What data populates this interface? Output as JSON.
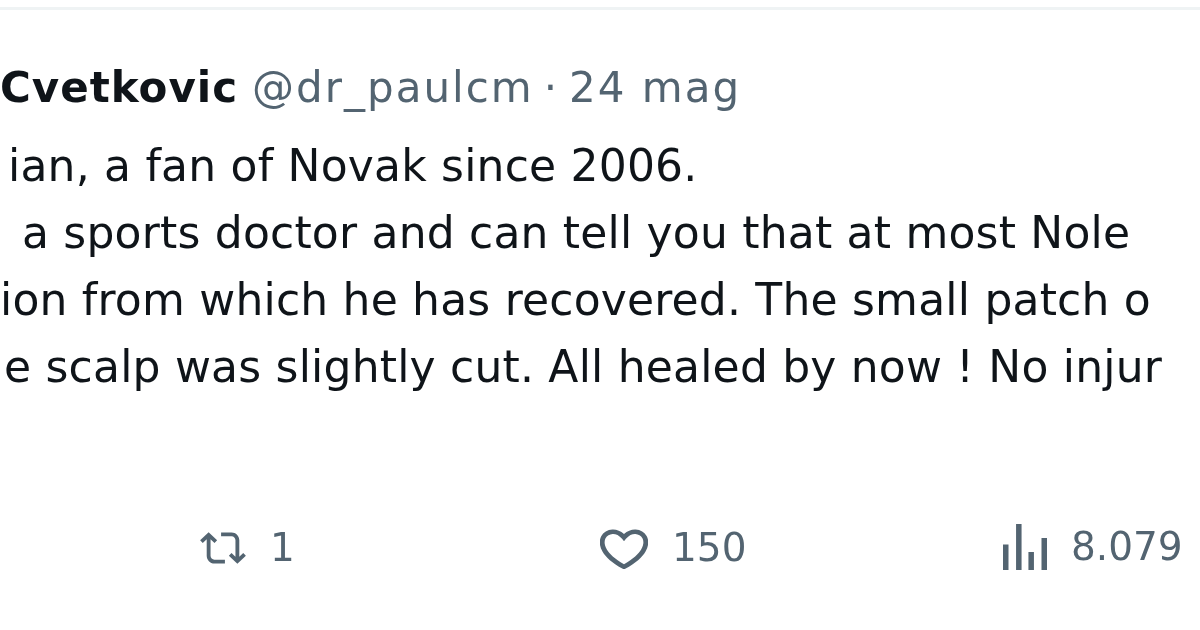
{
  "tweet": {
    "author_name": "Cvetkovic",
    "handle": "@dr_paulcm",
    "separator": "·",
    "date": "24 mag",
    "body_lines": [
      "ian, a fan of Novak since 2006.",
      "a sports doctor and can tell you that at most Nole",
      "ion from which he has recovered. The small patch o",
      "e scalp was slightly cut. All healed by now ! No injur"
    ],
    "actions": [
      {
        "kind": "retweet",
        "count": "1"
      },
      {
        "kind": "like",
        "count": "150"
      },
      {
        "kind": "views",
        "count": "8.079"
      }
    ]
  }
}
